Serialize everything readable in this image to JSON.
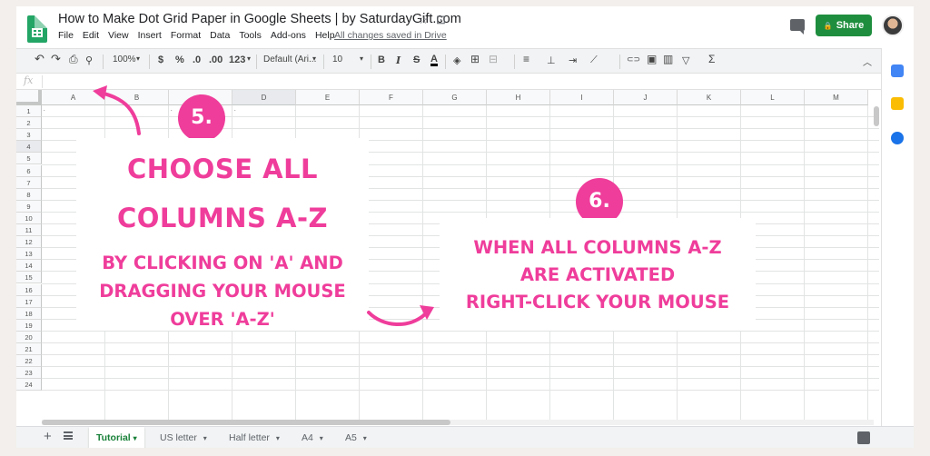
{
  "header": {
    "doc_title": "How to Make Dot Grid Paper in Google Sheets | by SaturdayGift.com",
    "star_icon": "☆",
    "folder_icon": "⊡",
    "menu": [
      "File",
      "Edit",
      "View",
      "Insert",
      "Format",
      "Data",
      "Tools",
      "Add-ons",
      "Help"
    ],
    "saved_status": "All changes saved in Drive",
    "share_label": "Share",
    "lock_icon": "🔒"
  },
  "toolbar": {
    "undo": "↶",
    "redo": "↷",
    "print": "⎙",
    "paint_format": "⚲",
    "zoom": "100%",
    "currency": "$",
    "percent": "%",
    "decimal_decrease": ".0",
    "decimal_increase": ".00",
    "more_formats": "123",
    "font": "Default (Ari...",
    "font_size": "10",
    "bold": "B",
    "italic": "I",
    "strikethrough": "S",
    "text_color": "A",
    "fill_icon": "◈",
    "borders_icon": "⊞",
    "merge_icon": "⊟",
    "align_h": "≡",
    "align_v": "⊥",
    "wrap": "⇥",
    "rotate": "⟋",
    "link": "⊂⊃",
    "comment": "▣",
    "chart": "▥",
    "filter": "▽",
    "functions": "Σ",
    "collapse": "︿",
    "dropdown": "▾"
  },
  "formula_bar": {
    "fx": "fx"
  },
  "grid": {
    "columns": [
      "A",
      "B",
      "C",
      "D",
      "E",
      "F",
      "G",
      "H",
      "I",
      "J",
      "K",
      "L",
      "M"
    ],
    "rows": [
      "1",
      "2",
      "3",
      "4",
      "5",
      "6",
      "7",
      "8",
      "9",
      "10",
      "11",
      "12",
      "13",
      "14",
      "15",
      "16",
      "17",
      "18",
      "19",
      "20",
      "21",
      "22",
      "23",
      "24"
    ],
    "dot": "."
  },
  "sheets": {
    "add_icon": "+",
    "tabs": [
      "Tutorial",
      "US letter",
      "Half letter",
      "A4",
      "A5"
    ],
    "active": "Tutorial",
    "dropdown": "▾"
  },
  "rail": {
    "chevron": "›"
  },
  "overlay": {
    "step5_number": "5.",
    "step5_title_line1": "CHOOSE ALL",
    "step5_title_line2": "COLUMNS A-Z",
    "step5_desc_line1": "BY CLICKING ON 'A' AND",
    "step5_desc_line2": "DRAGGING YOUR MOUSE",
    "step5_desc_line3": "OVER 'A-Z'",
    "step6_number": "6.",
    "step6_line1": "WHEN ALL COLUMNS A-Z",
    "step6_line2": "ARE ACTIVATED",
    "step6_line3": "RIGHT-CLICK YOUR MOUSE"
  },
  "colors": {
    "accent_pink": "#ef3d9b",
    "share_green": "#1e8e3e",
    "active_tab_green": "#188038"
  }
}
